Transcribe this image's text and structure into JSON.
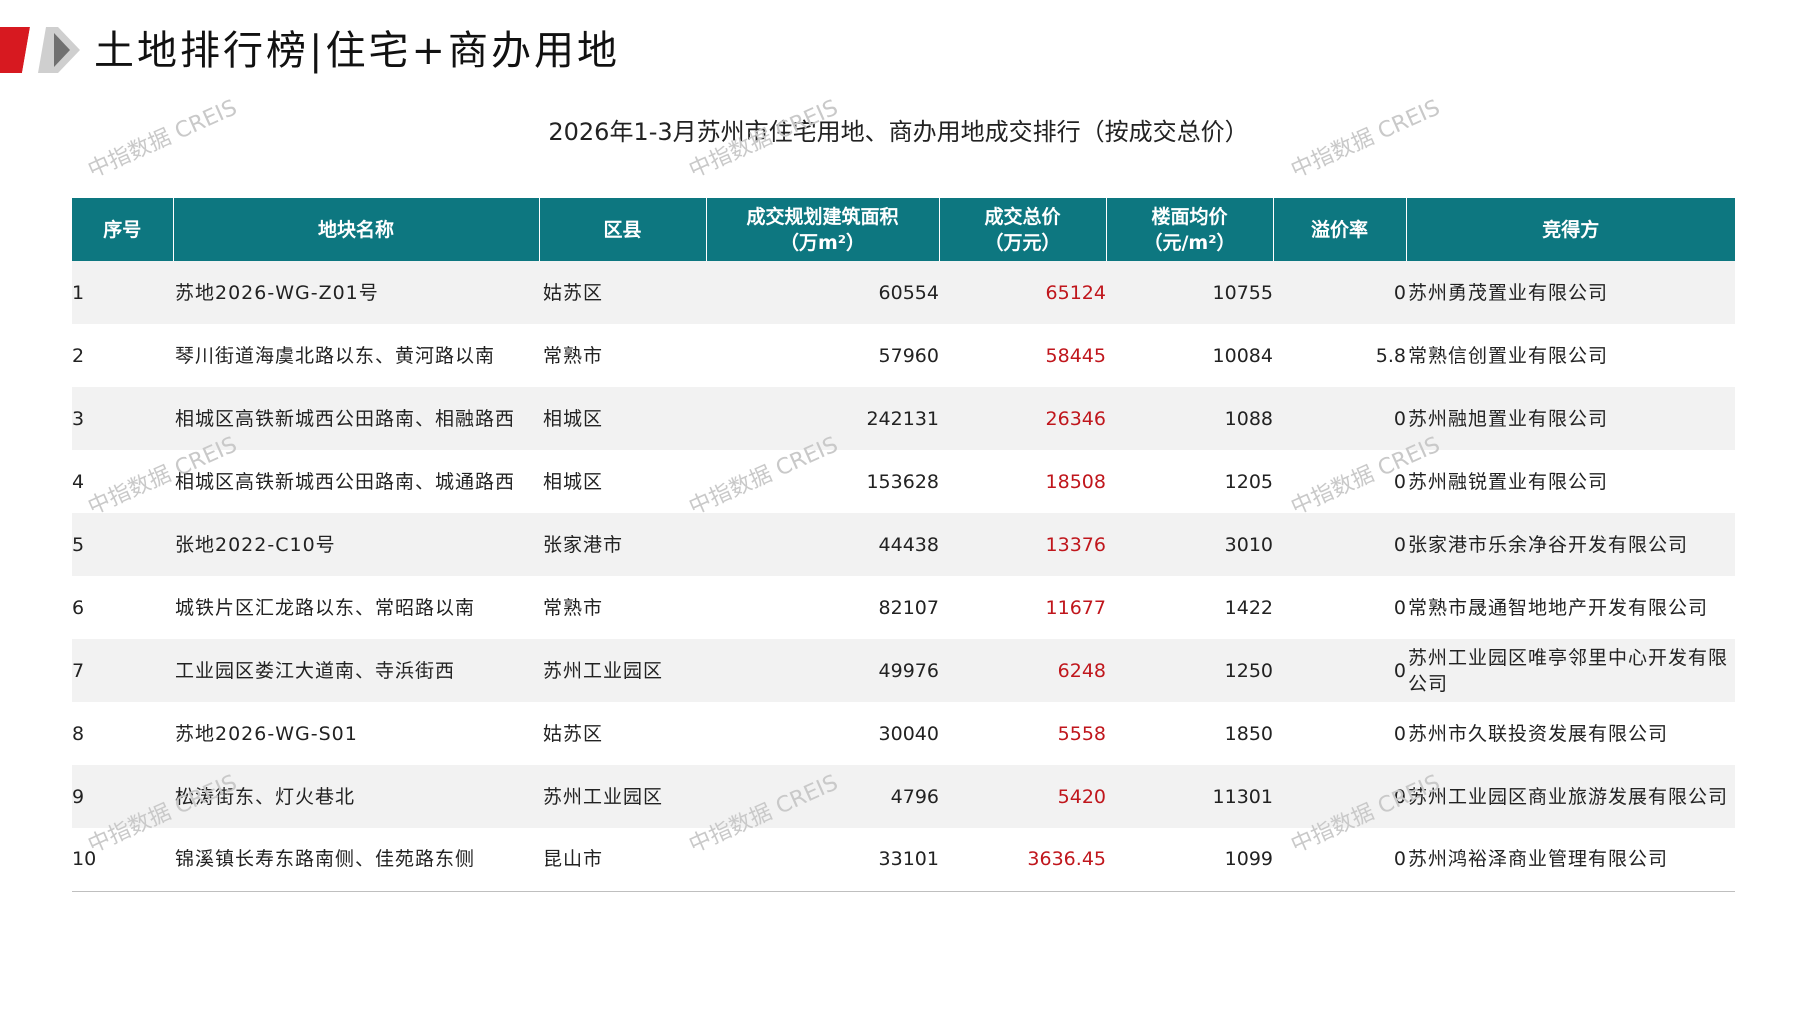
{
  "header": {
    "title": "土地排行榜|住宅+商办用地"
  },
  "table_title": "2026年1-3月苏州市住宅用地、商办用地成交排行（按成交总价）",
  "watermark_text": "中指数据 CREIS",
  "columns": {
    "rank": "序号",
    "name": "地块名称",
    "district": "区县",
    "area_line1": "成交规划建筑面积",
    "area_line2": "（万m²）",
    "total_line1": "成交总价",
    "total_line2": "（万元）",
    "unit_line1": "楼面均价",
    "unit_line2": "（元/m²）",
    "premium": "溢价率",
    "winner": "竞得方"
  },
  "rows": [
    {
      "rank": "1",
      "name": "苏地2026-WG-Z01号",
      "district": "姑苏区",
      "area": "60554",
      "total": "65124",
      "unit_price": "10755",
      "premium": "0",
      "winner": "苏州勇茂置业有限公司"
    },
    {
      "rank": "2",
      "name": "琴川街道海虞北路以东、黄河路以南",
      "district": "常熟市",
      "area": "57960",
      "total": "58445",
      "unit_price": "10084",
      "premium": "5.8",
      "winner": "常熟信创置业有限公司"
    },
    {
      "rank": "3",
      "name": "相城区高铁新城西公田路南、相融路西",
      "district": "相城区",
      "area": "242131",
      "total": "26346",
      "unit_price": "1088",
      "premium": "0",
      "winner": "苏州融旭置业有限公司"
    },
    {
      "rank": "4",
      "name": "相城区高铁新城西公田路南、城通路西",
      "district": "相城区",
      "area": "153628",
      "total": "18508",
      "unit_price": "1205",
      "premium": "0",
      "winner": "苏州融锐置业有限公司"
    },
    {
      "rank": "5",
      "name": "张地2022-C10号",
      "district": "张家港市",
      "area": "44438",
      "total": "13376",
      "unit_price": "3010",
      "premium": "0",
      "winner": "张家港市乐余净谷开发有限公司"
    },
    {
      "rank": "6",
      "name": "城铁片区汇龙路以东、常昭路以南",
      "district": "常熟市",
      "area": "82107",
      "total": "11677",
      "unit_price": "1422",
      "premium": "0",
      "winner": "常熟市晟通智地地产开发有限公司"
    },
    {
      "rank": "7",
      "name": "工业园区娄江大道南、寺浜街西",
      "district": "苏州工业园区",
      "area": "49976",
      "total": "6248",
      "unit_price": "1250",
      "premium": "0",
      "winner": "苏州工业园区唯亭邻里中心开发有限公司"
    },
    {
      "rank": "8",
      "name": "苏地2026-WG-S01",
      "district": "姑苏区",
      "area": "30040",
      "total": "5558",
      "unit_price": "1850",
      "premium": "0",
      "winner": "苏州市久联投资发展有限公司"
    },
    {
      "rank": "9",
      "name": "松涛街东、灯火巷北",
      "district": "苏州工业园区",
      "area": "4796",
      "total": "5420",
      "unit_price": "11301",
      "premium": "0",
      "winner": "苏州工业园区商业旅游发展有限公司"
    },
    {
      "rank": "10",
      "name": "锦溪镇长寿东路南侧、佳苑路东侧",
      "district": "昆山市",
      "area": "33101",
      "total": "3636.45",
      "unit_price": "1099",
      "premium": "0",
      "winner": "苏州鸿裕泽商业管理有限公司"
    }
  ],
  "colors": {
    "header_bg": "#0d7780",
    "total_price": "#c0161c",
    "logo_red": "#d71920",
    "logo_gray": "#8c8c8c"
  }
}
